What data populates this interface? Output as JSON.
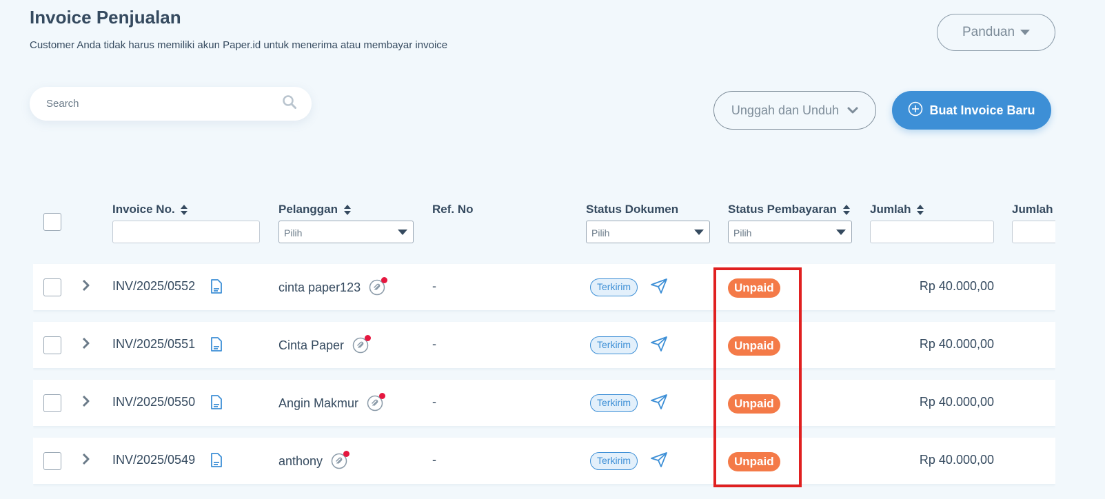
{
  "header": {
    "title": "Invoice Penjualan",
    "subtitle": "Customer Anda tidak harus memiliki akun Paper.id untuk menerima atau membayar invoice",
    "guide_label": "Panduan"
  },
  "search": {
    "placeholder": "Search",
    "value": ""
  },
  "actions": {
    "upload_download_label": "Unggah dan Unduh",
    "create_label": "Buat Invoice Baru"
  },
  "table": {
    "columns": {
      "invoice_no": "Invoice No.",
      "customer": "Pelanggan",
      "ref_no": "Ref. No",
      "doc_status": "Status Dokumen",
      "pay_status": "Status Pembayaran",
      "amount": "Jumlah",
      "amount_partial": "Jumlah T"
    },
    "filters": {
      "customer": "Pilih",
      "doc_status": "Pilih",
      "pay_status": "Pilih"
    },
    "rows": [
      {
        "invoice_no": "INV/2025/0552",
        "customer": "cinta paper123",
        "ref_no": "-",
        "doc_status": "Terkirim",
        "pay_status": "Unpaid",
        "amount": "Rp 40.000,00"
      },
      {
        "invoice_no": "INV/2025/0551",
        "customer": "Cinta Paper",
        "ref_no": "-",
        "doc_status": "Terkirim",
        "pay_status": "Unpaid",
        "amount": "Rp 40.000,00"
      },
      {
        "invoice_no": "INV/2025/0550",
        "customer": "Angin Makmur",
        "ref_no": "-",
        "doc_status": "Terkirim",
        "pay_status": "Unpaid",
        "amount": "Rp 40.000,00"
      },
      {
        "invoice_no": "INV/2025/0549",
        "customer": "anthony",
        "ref_no": "-",
        "doc_status": "Terkirim",
        "pay_status": "Unpaid",
        "amount": "Rp 40.000,00"
      }
    ]
  },
  "colors": {
    "primary": "#3d8fd6",
    "unpaid": "#f47a48",
    "highlight": "#e02020",
    "background": "#f2f8fc",
    "notification_dot": "#e5173f"
  },
  "icons": [
    "chevron-down-icon",
    "search-icon",
    "plus-circle-icon",
    "sort-icon",
    "chevron-right-icon",
    "document-icon",
    "attachment-icon",
    "send-icon"
  ]
}
